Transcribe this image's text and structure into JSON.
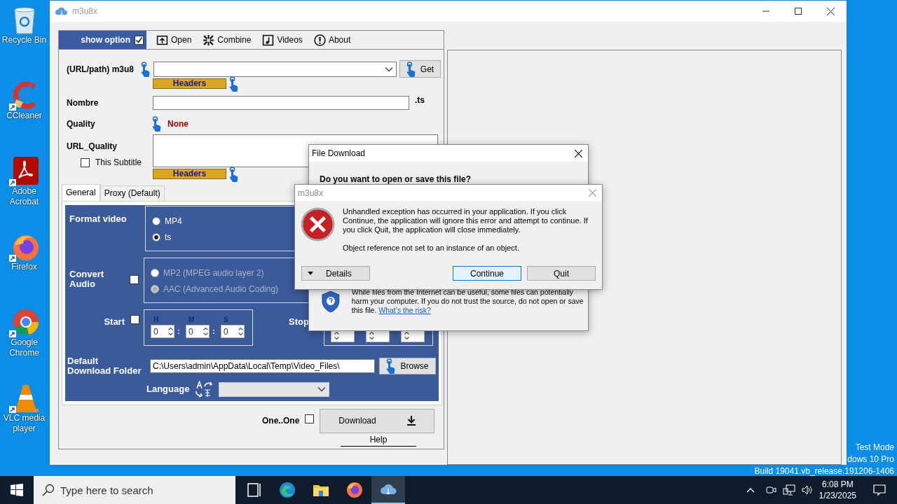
{
  "desktop": {
    "icons": [
      {
        "label": "Recycle Bin",
        "kind": "recycle-bin"
      },
      {
        "label": "CCleaner",
        "kind": "ccleaner"
      },
      {
        "label": "Adobe Acrobat",
        "kind": "acrobat"
      },
      {
        "label": "Firefox",
        "kind": "firefox"
      },
      {
        "label": "Google Chrome",
        "kind": "chrome"
      },
      {
        "label": "VLC media player",
        "kind": "vlc"
      }
    ],
    "system_text": [
      "Test Mode",
      "dows 10 Pro",
      "Build 19041.vb_release.191206-1406"
    ]
  },
  "main_window": {
    "title": "m3u8x",
    "show_option": {
      "label": "show option",
      "checked": true
    },
    "toolbar": [
      {
        "label": "Open",
        "kind": "open"
      },
      {
        "label": "Combine",
        "kind": "combine"
      },
      {
        "label": "Videos",
        "kind": "videos"
      },
      {
        "label": "About",
        "kind": "about"
      }
    ],
    "url_label": "(URL/path) m3u8",
    "get_button": "Get",
    "url_headers": "Headers",
    "name_label": "Nombre",
    "name_suffix": ".ts",
    "quality_label": "Quality",
    "quality_value": "None",
    "url_quality_label": "URL_Quality",
    "subtitle": {
      "label": "This Subtitle",
      "checked": false
    },
    "quality_headers": "Headers",
    "tabs": [
      {
        "label": "General",
        "selected": true
      },
      {
        "label": "Proxy (Default)",
        "selected": false
      }
    ],
    "general": {
      "format_label": "Format video",
      "formats": [
        {
          "label": "MP4",
          "selected": false
        },
        {
          "label": "ts",
          "selected": true
        }
      ],
      "convert_audio": {
        "label": "Convert Audio",
        "checked": false
      },
      "audio_formats": [
        {
          "label": "MP2 (MPEG audio layer 2)",
          "selected": false,
          "disabled": true
        },
        {
          "label": "AAC (Advanced Audio Coding)",
          "selected": true,
          "disabled": true
        }
      ],
      "start": {
        "label": "Start",
        "checked": false,
        "fields": [
          {
            "unit": "H",
            "value": "0"
          },
          {
            "unit": "M",
            "value": "0"
          },
          {
            "unit": "S",
            "value": "0"
          }
        ],
        "separators": [
          ":",
          ":"
        ]
      },
      "stop_label": "Stop",
      "folder_label": "Default Download Folder",
      "folder_value": "C:\\Users\\admin\\AppData\\Local\\Temp\\Video_Files\\",
      "browse_button": "Browse",
      "language_label": "Language"
    },
    "one_by_one": {
      "label": "One..One",
      "checked": false
    },
    "download_button": "Download",
    "help_link": "Help"
  },
  "file_download": {
    "title": "File Download",
    "question": "Do you want to open or save this file?",
    "warning": "While files from the Internet can be useful, some files can potentially harm your computer. If you do not trust the source, do not open or save this file.",
    "risk_link": "What’s the risk?"
  },
  "error_dialog": {
    "title": "m3u8x",
    "message": "Unhandled exception has occurred in your application. If you click Continue, the application will ignore this error and attempt to continue. If you click Quit, the application will close immediately.",
    "detail": "Object reference not set to an instance of an object.",
    "buttons": [
      {
        "label": "Details",
        "kind": "details"
      },
      {
        "label": "Continue",
        "kind": "default"
      },
      {
        "label": "Quit",
        "kind": "plain"
      }
    ]
  },
  "taskbar": {
    "search_placeholder": "Type here to search",
    "apps": [
      {
        "kind": "task-view",
        "selected": false
      },
      {
        "kind": "edge",
        "selected": false
      },
      {
        "kind": "explorer",
        "selected": false
      },
      {
        "kind": "firefox",
        "selected": false
      },
      {
        "kind": "m3u8x",
        "selected": true
      }
    ],
    "time": "6:08 PM",
    "date": "1/23/2025"
  }
}
